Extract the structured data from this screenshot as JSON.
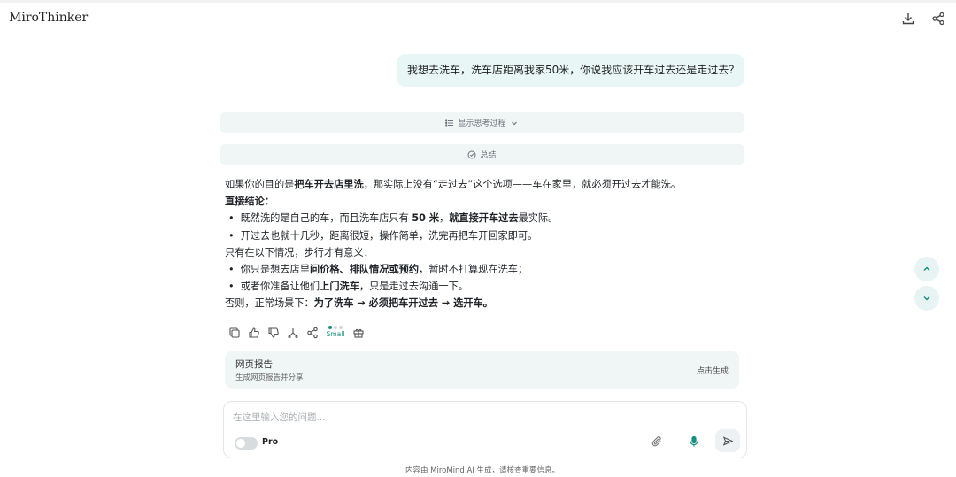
{
  "app": {
    "title": "MiroThinker"
  },
  "user_message": "我想去洗车，洗车店距离我家50米，你说我应该开车过去还是走过去？",
  "thinking_toggle": {
    "label": "显示思考过程"
  },
  "summary_bar": {
    "label": "总结"
  },
  "answer": {
    "line1": {
      "a": "如果你的目的是",
      "b": "把车开去店里洗",
      "c": "，那实际上没有“走过去”这个选项——车在家里，就必须开过去才能洗。"
    },
    "heading": "直接结论：",
    "bullet1": {
      "a": "既然洗的是自己的车，而且洗车店只有 ",
      "b": "50 米",
      "c": "，",
      "d": "就直接开车过去",
      "e": "最实际。"
    },
    "bullet2": "开过去也就十几秒，距离很短，操作简单，洗完再把车开回家即可。",
    "line_cond": "只有在以下情况，步行才有意义：",
    "bullet3": {
      "a": "你只是想去店里",
      "b": "问价格、排队情况或预约",
      "c": "，暂时不打算现在洗车；"
    },
    "bullet4": {
      "a": "或者你准备让他们",
      "b": "上门洗车",
      "c": "，只是走过去沟通一下。"
    },
    "conclusion": {
      "a": "否则，正常场景下：",
      "b": "为了洗车 → 必须把车开过去 → 选开车。"
    }
  },
  "actions": {
    "model_label": "Small"
  },
  "report_card": {
    "title": "网页报告",
    "subtitle": "生成网页报告并分享",
    "action_label": "点击生成"
  },
  "composer": {
    "placeholder": "在这里输入您的问题...",
    "pro_label": "Pro"
  },
  "disclaimer": "内容由 MiroMind AI 生成，请核查重要信息。",
  "colors": {
    "accent": "#1a8f7e",
    "bubble_bg": "#e8f6f5",
    "panel_bg": "#f0f5f6"
  },
  "icons": [
    "download-icon",
    "share-icon",
    "list-icon",
    "chevron-down-icon",
    "check-circle-icon",
    "copy-icon",
    "thumbs-up-icon",
    "thumbs-down-icon",
    "branch-icon",
    "gift-icon",
    "paperclip-icon",
    "mic-icon",
    "send-icon",
    "chevron-up-icon"
  ]
}
